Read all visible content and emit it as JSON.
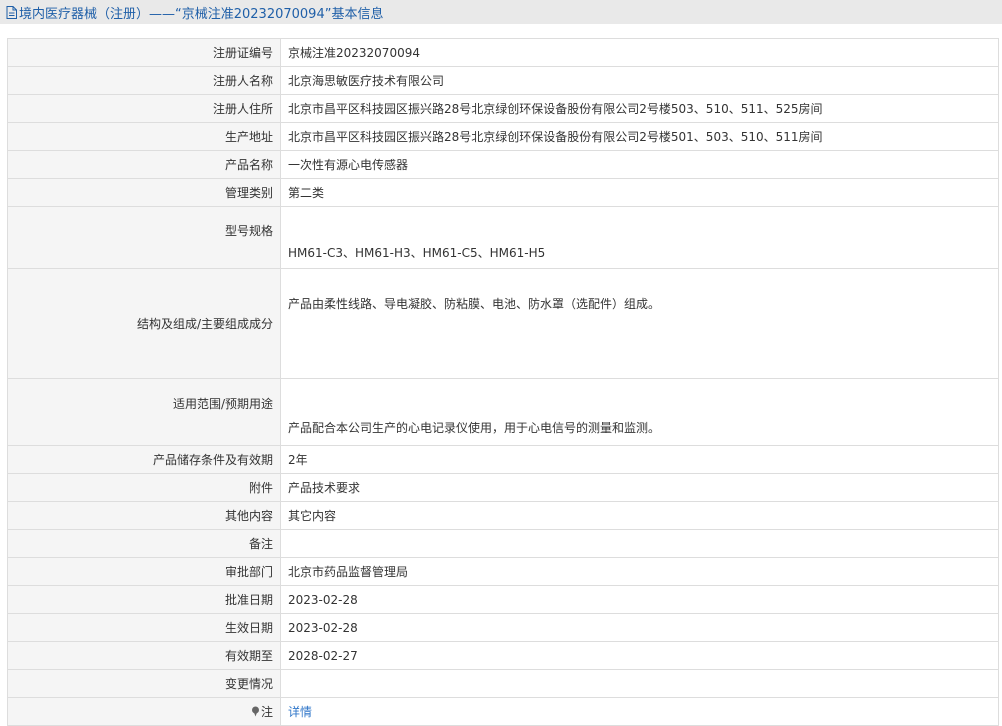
{
  "header": {
    "icon": "document-icon",
    "title": "境内医疗器械（注册）——“京械注准20232070094”基本信息"
  },
  "rows": [
    {
      "label": "注册证编号",
      "value": "京械注准20232070094"
    },
    {
      "label": "注册人名称",
      "value": "北京海思敏医疗技术有限公司"
    },
    {
      "label": "注册人住所",
      "value": "北京市昌平区科技园区振兴路28号北京绿创环保设备股份有限公司2号楼503、510、511、525房间"
    },
    {
      "label": "生产地址",
      "value": "北京市昌平区科技园区振兴路28号北京绿创环保设备股份有限公司2号楼501、503、510、511房间"
    },
    {
      "label": "产品名称",
      "value": "一次性有源心电传感器"
    },
    {
      "label": "管理类别",
      "value": "第二类"
    },
    {
      "label": "型号规格",
      "value": "HM61-C3、HM61-H3、HM61-C5、HM61-H5"
    },
    {
      "label": "结构及组成/主要组成成分",
      "value": "产品由柔性线路、导电凝胶、防粘膜、电池、防水罩（选配件）组成。"
    },
    {
      "label": "适用范围/预期用途",
      "value": "产品配合本公司生产的心电记录仪使用，用于心电信号的测量和监测。"
    },
    {
      "label": "产品储存条件及有效期",
      "value": "2年"
    },
    {
      "label": "附件",
      "value": "产品技术要求"
    },
    {
      "label": "其他内容",
      "value": "其它内容"
    },
    {
      "label": "备注",
      "value": ""
    },
    {
      "label": "审批部门",
      "value": "北京市药品监督管理局"
    },
    {
      "label": "批准日期",
      "value": "2023-02-28"
    },
    {
      "label": "生效日期",
      "value": "2023-02-28"
    },
    {
      "label": "有效期至",
      "value": "2028-02-27"
    },
    {
      "label": "变更情况",
      "value": ""
    },
    {
      "label": "注",
      "value": "详情",
      "icon": "pin-icon"
    }
  ],
  "colors": {
    "header_bg": "#e9e9e9",
    "title": "#1f5fa8",
    "link": "#2f76c9",
    "label_bg": "#f5f5f5",
    "border": "#dddddd"
  }
}
